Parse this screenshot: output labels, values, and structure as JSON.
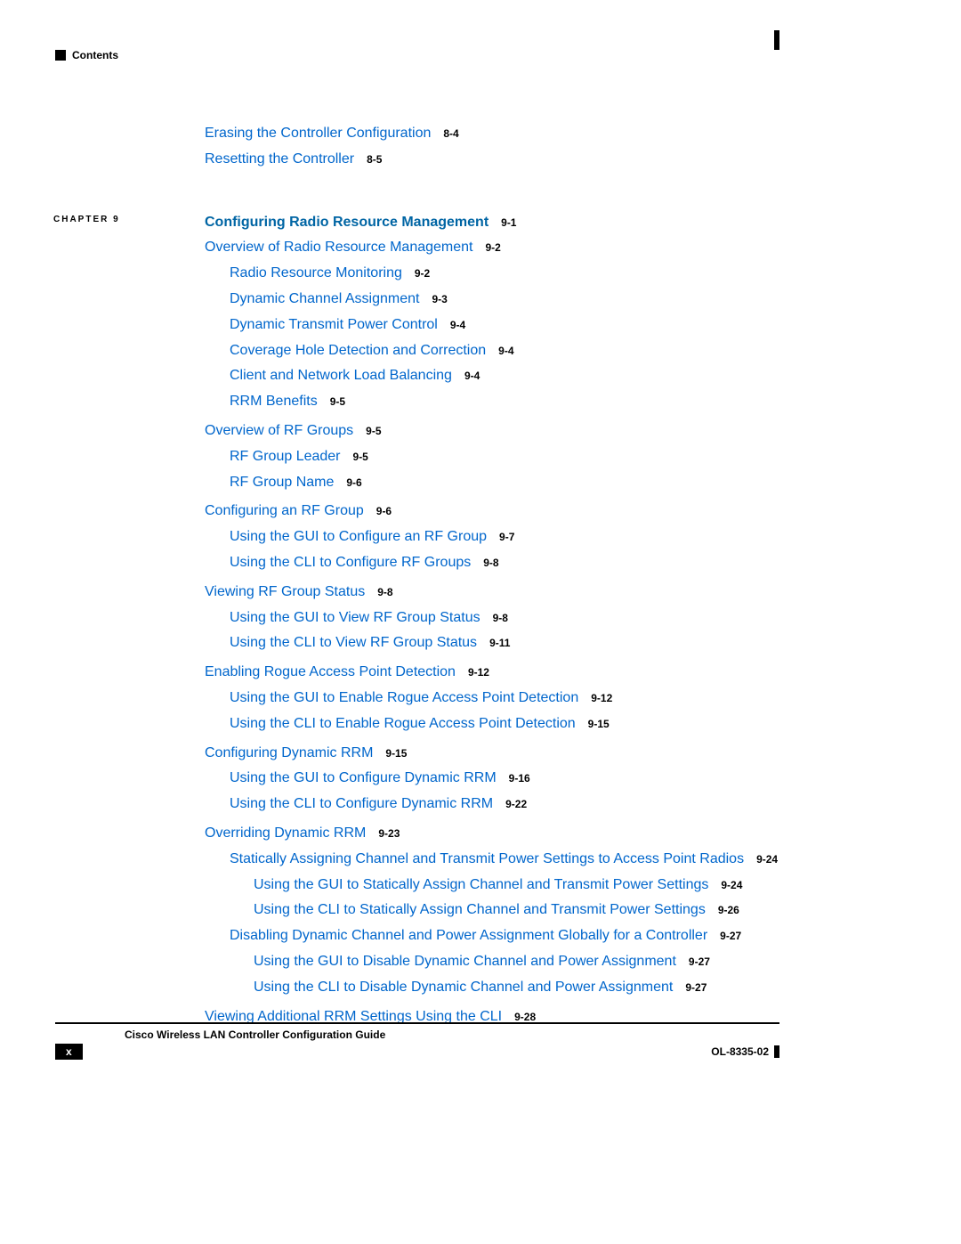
{
  "header": {
    "label": "Contents"
  },
  "pre_chapter": [
    {
      "text": "Erasing the Controller Configuration",
      "page": "8-4",
      "indent": 0
    },
    {
      "text": "Resetting the Controller",
      "page": "8-5",
      "indent": 0
    }
  ],
  "chapter": {
    "label": "CHAPTER 9",
    "title": "Configuring Radio Resource Management",
    "page": "9-1"
  },
  "entries": [
    {
      "text": "Overview of Radio Resource Management",
      "page": "9-2",
      "indent": 0,
      "block": 1
    },
    {
      "text": "Radio Resource Monitoring",
      "page": "9-2",
      "indent": 1,
      "block": 1
    },
    {
      "text": "Dynamic Channel Assignment",
      "page": "9-3",
      "indent": 1,
      "block": 1
    },
    {
      "text": "Dynamic Transmit Power Control",
      "page": "9-4",
      "indent": 1,
      "block": 1
    },
    {
      "text": "Coverage Hole Detection and Correction",
      "page": "9-4",
      "indent": 1,
      "block": 1
    },
    {
      "text": "Client and Network Load Balancing",
      "page": "9-4",
      "indent": 1,
      "block": 1
    },
    {
      "text": "RRM Benefits",
      "page": "9-5",
      "indent": 1,
      "block": 1
    },
    {
      "text": "Overview of RF Groups",
      "page": "9-5",
      "indent": 0,
      "block": 2
    },
    {
      "text": "RF Group Leader",
      "page": "9-5",
      "indent": 1,
      "block": 2
    },
    {
      "text": "RF Group Name",
      "page": "9-6",
      "indent": 1,
      "block": 2
    },
    {
      "text": "Configuring an RF Group",
      "page": "9-6",
      "indent": 0,
      "block": 3
    },
    {
      "text": "Using the GUI to Configure an RF Group",
      "page": "9-7",
      "indent": 1,
      "block": 3
    },
    {
      "text": "Using the CLI to Configure RF Groups",
      "page": "9-8",
      "indent": 1,
      "block": 3
    },
    {
      "text": "Viewing RF Group Status",
      "page": "9-8",
      "indent": 0,
      "block": 4
    },
    {
      "text": "Using the GUI to View RF Group Status",
      "page": "9-8",
      "indent": 1,
      "block": 4
    },
    {
      "text": "Using the CLI to View RF Group Status",
      "page": "9-11",
      "indent": 1,
      "block": 4
    },
    {
      "text": "Enabling Rogue Access Point Detection",
      "page": "9-12",
      "indent": 0,
      "block": 5
    },
    {
      "text": "Using the GUI to Enable Rogue Access Point Detection",
      "page": "9-12",
      "indent": 1,
      "block": 5
    },
    {
      "text": "Using the CLI to Enable Rogue Access Point Detection",
      "page": "9-15",
      "indent": 1,
      "block": 5
    },
    {
      "text": "Configuring Dynamic RRM",
      "page": "9-15",
      "indent": 0,
      "block": 6
    },
    {
      "text": "Using the GUI to Configure Dynamic RRM",
      "page": "9-16",
      "indent": 1,
      "block": 6
    },
    {
      "text": "Using the CLI to Configure Dynamic RRM",
      "page": "9-22",
      "indent": 1,
      "block": 6
    },
    {
      "text": "Overriding Dynamic RRM",
      "page": "9-23",
      "indent": 0,
      "block": 7
    },
    {
      "text": "Statically Assigning Channel and Transmit Power Settings to Access Point Radios",
      "page": "9-24",
      "indent": 1,
      "block": 7
    },
    {
      "text": "Using the GUI to Statically Assign Channel and Transmit Power Settings",
      "page": "9-24",
      "indent": 2,
      "block": 7
    },
    {
      "text": "Using the CLI to Statically Assign Channel and Transmit Power Settings",
      "page": "9-26",
      "indent": 2,
      "block": 7
    },
    {
      "text": "Disabling Dynamic Channel and Power Assignment Globally for a Controller",
      "page": "9-27",
      "indent": 1,
      "block": 7
    },
    {
      "text": "Using the GUI to Disable Dynamic Channel and Power Assignment",
      "page": "9-27",
      "indent": 2,
      "block": 7
    },
    {
      "text": "Using the CLI to Disable Dynamic Channel and Power Assignment",
      "page": "9-27",
      "indent": 2,
      "block": 7
    },
    {
      "text": "Viewing Additional RRM Settings Using the CLI",
      "page": "9-28",
      "indent": 0,
      "block": 8
    }
  ],
  "footer": {
    "title": "Cisco Wireless LAN Controller Configuration Guide",
    "page_number": "x",
    "doc_id": "OL-8335-02"
  }
}
